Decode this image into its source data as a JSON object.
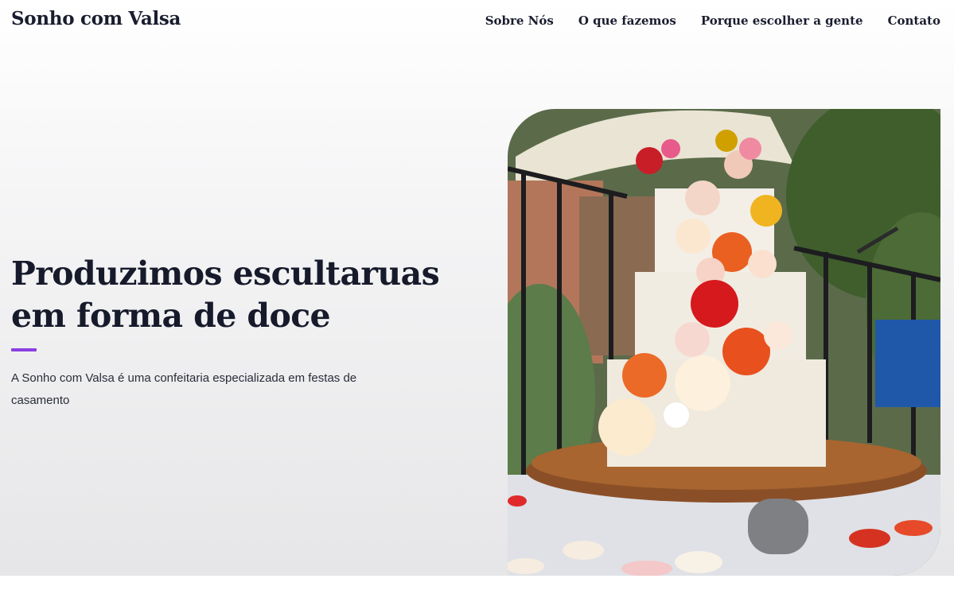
{
  "header": {
    "brand": "Sonho com Valsa",
    "nav": [
      {
        "label": "Sobre Nós"
      },
      {
        "label": "O que fazemos"
      },
      {
        "label": "Porque escolher a gente"
      },
      {
        "label": "Contato"
      }
    ]
  },
  "hero": {
    "title_line1": "Produzimos escultaruas",
    "title_line2": "em forma de doce",
    "description": "A Sonho com Valsa é uma confeitaria especializada em festas de casamento",
    "image_subject": "wedding-cake-with-roses-photo"
  },
  "colors": {
    "accent": "#8b3fe0",
    "text_dark": "#161a2b"
  }
}
